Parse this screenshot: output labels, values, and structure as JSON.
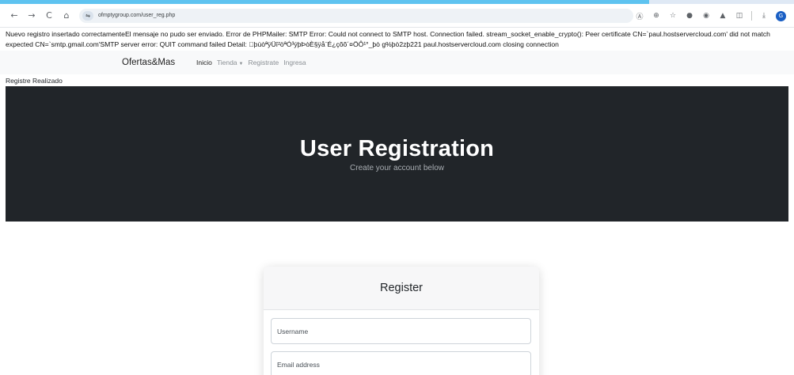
{
  "browser": {
    "url": "ofmptygroup.com/user_reg.php",
    "icons": [
      "back-icon",
      "forward-icon",
      "reload-icon",
      "home-icon",
      "site-info-icon",
      "translate-icon",
      "zoom-icon",
      "bookmark-star-icon",
      "extension-icon",
      "extension-icon",
      "extension-icon",
      "extensions-puzzle-icon",
      "download-icon",
      "profile-avatar"
    ],
    "profile_initial": "G"
  },
  "error_message": "Nuevo registro insertado correctamenteEl mensaje no pudo ser enviado. Error de PHPMailer: SMTP Error: Could not connect to SMTP host. Connection failed. stream_socket_enable_crypto(): Peer certificate CN=`paul.hostservercloud.com' did not match expected CN=`smtp.gmail.com'SMTP server error: QUIT command failed Detail: \u0000þùòªÿÜ­î²öªÓ³ýþÞòÈ§ÿå¨É¿çõõ´¤ÖÔ¹°_þò g%þò2zþ221 paul.hostservercloud.com closing connection",
  "navbar": {
    "brand": "Ofertas&Mas",
    "links": {
      "inicio": "Inicio",
      "tienda": "Tienda",
      "registrate": "Registrate",
      "ingresa": "Ingresa"
    }
  },
  "status_text": "Registre Realizado",
  "hero": {
    "title": "User Registration",
    "subtitle": "Create your account below"
  },
  "register_card": {
    "title": "Register",
    "username_placeholder": "Username",
    "email_placeholder": "Email address"
  },
  "colors": {
    "hero_bg": "#212529",
    "navbar_bg": "#f8f9fa",
    "tab_accent": "#5ec3f0"
  }
}
